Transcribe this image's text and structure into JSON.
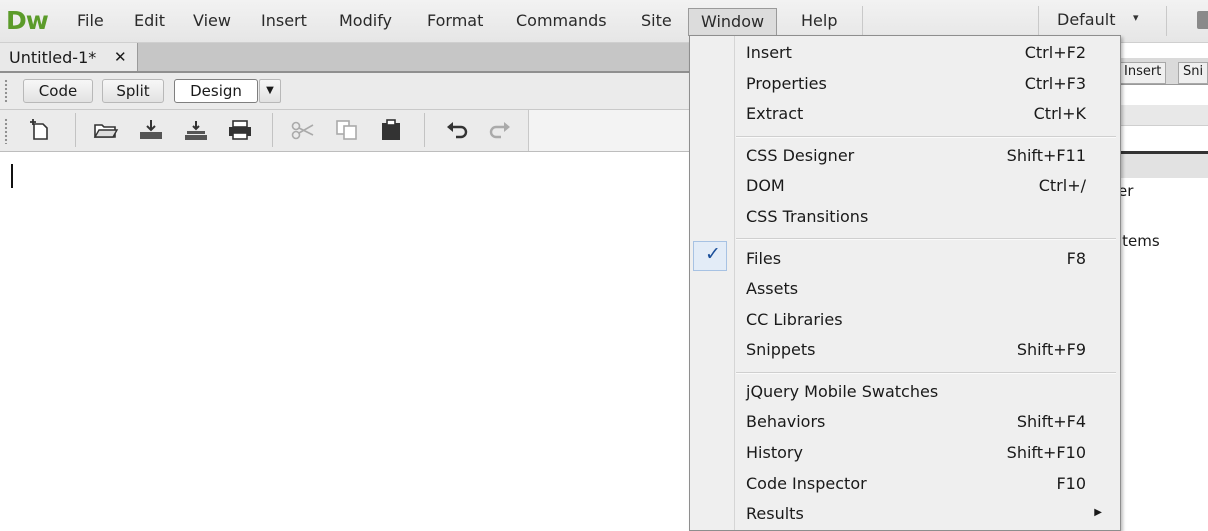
{
  "app": {
    "logo": "Dw"
  },
  "menubar": {
    "items": [
      "File",
      "Edit",
      "View",
      "Insert",
      "Modify",
      "Format",
      "Commands",
      "Site",
      "Window",
      "Help"
    ],
    "workspace": "Default",
    "workspace_caret": "▾",
    "open_menu": "Window"
  },
  "document": {
    "tab_label": "Untitled-1*",
    "tab_close": "✕"
  },
  "view_buttons": {
    "code": "Code",
    "split": "Split",
    "design": "Design",
    "dropdown": "▼",
    "active": "Design"
  },
  "toolbar_icons": [
    "new-document-icon",
    "open-folder-icon",
    "save-icon",
    "save-all-icon",
    "print-icon",
    "cut-icon",
    "copy-icon",
    "paste-icon",
    "undo-icon",
    "redo-icon"
  ],
  "right_panel": {
    "tabs": [
      "Insert",
      "Sni"
    ],
    "text_lines": [
      "er",
      "items"
    ]
  },
  "window_menu": {
    "groups": [
      [
        {
          "label": "Insert",
          "shortcut": "Ctrl+F2"
        },
        {
          "label": "Properties",
          "shortcut": "Ctrl+F3"
        },
        {
          "label": "Extract",
          "shortcut": "Ctrl+K"
        }
      ],
      [
        {
          "label": "CSS Designer",
          "shortcut": "Shift+F11"
        },
        {
          "label": "DOM",
          "shortcut": "Ctrl+/"
        },
        {
          "label": "CSS Transitions",
          "shortcut": ""
        }
      ],
      [
        {
          "label": "Files",
          "shortcut": "F8",
          "checked": true
        },
        {
          "label": "Assets",
          "shortcut": ""
        },
        {
          "label": "CC Libraries",
          "shortcut": ""
        },
        {
          "label": "Snippets",
          "shortcut": "Shift+F9"
        }
      ],
      [
        {
          "label": "jQuery Mobile Swatches",
          "shortcut": ""
        },
        {
          "label": "Behaviors",
          "shortcut": "Shift+F4"
        },
        {
          "label": "History",
          "shortcut": "Shift+F10"
        },
        {
          "label": "Code Inspector",
          "shortcut": "F10"
        },
        {
          "label": "Results",
          "shortcut": "",
          "submenu": true
        }
      ]
    ],
    "check_glyph": "✓",
    "submenu_glyph": "▶"
  },
  "colors": {
    "logo": "#5b9b2a",
    "check": "#1b4f9a"
  }
}
